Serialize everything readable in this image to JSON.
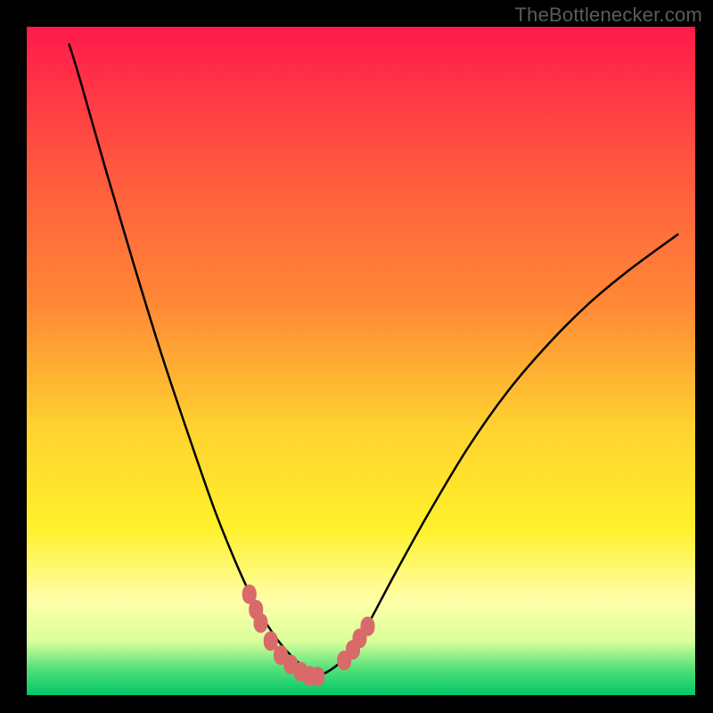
{
  "watermark": "TheBottlenecker.com",
  "chart_data": {
    "type": "line",
    "title": "",
    "xlabel": "",
    "ylabel": "",
    "xlim": [
      0,
      100
    ],
    "ylim": [
      0,
      100
    ],
    "series": [
      {
        "name": "curve-left",
        "x": [
          6.3,
          8,
          12,
          16,
          20,
          24,
          28,
          31,
          33,
          34.5,
          36,
          37.5,
          39,
          40.5,
          42,
          43.5
        ],
        "values": [
          97.5,
          92,
          78,
          64.5,
          51.5,
          39.5,
          28,
          20.5,
          16,
          13,
          10.5,
          8.3,
          6.5,
          5,
          3.8,
          2.9
        ]
      },
      {
        "name": "curve-right",
        "x": [
          43.5,
          45,
          47,
          49,
          51,
          55,
          60,
          66,
          72,
          78,
          84,
          90,
          97.5
        ],
        "values": [
          2.9,
          3.5,
          5,
          7.5,
          10.5,
          18,
          27,
          37,
          45.5,
          52.5,
          58.5,
          63.5,
          69
        ]
      },
      {
        "name": "markers-left-cluster",
        "x": [
          33.3,
          34.3,
          35,
          36.5,
          38,
          39.5,
          41,
          42.3,
          43.5
        ],
        "values": [
          15.1,
          12.8,
          10.8,
          8.1,
          6,
          4.6,
          3.5,
          2.9,
          2.8
        ]
      },
      {
        "name": "markers-right-cluster",
        "x": [
          47.5,
          48.8,
          49.8,
          51
        ],
        "values": [
          5.2,
          6.8,
          8.5,
          10.3
        ]
      }
    ],
    "gradient_colors": {
      "top": "#ff1a4b",
      "upper_mid": "#ff8a36",
      "mid": "#ffd230",
      "lower_mid": "#fff12a",
      "pale": "#ffffaa",
      "green_edge": "#55e07a",
      "green": "#00e87a",
      "deep_green": "#00c768"
    },
    "marker_color": "#d96a6a",
    "curve_color": "#000000",
    "frame_color": "#000000"
  }
}
